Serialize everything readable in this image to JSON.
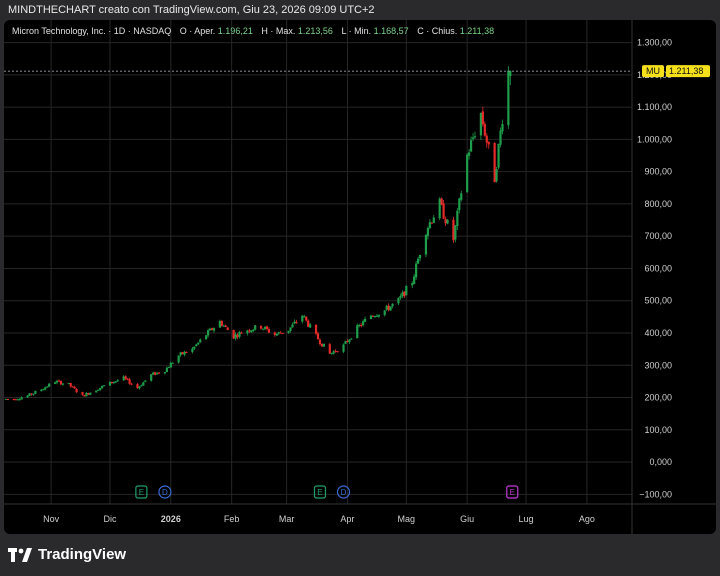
{
  "header": {
    "credit": "MINDTHECHART creato con TradingView.com, Giu 23, 2026 09:09 UTC+2"
  },
  "legend": {
    "symbol": "Micron Technology, Inc. · 1D · NASDAQ",
    "open_label": "O · Aper.",
    "open": "1.196,21",
    "high_label": "H · Max.",
    "high": "1.213,56",
    "low_label": "L · Min.",
    "low": "1.168,57",
    "close_label": "C · Chius.",
    "close": "1.211,38"
  },
  "price_tag": {
    "ticker": "MU",
    "value": "1.211,38",
    "color": "#f5e11b"
  },
  "footer": {
    "brand": "TradingView"
  },
  "colors": {
    "up": "#1e9e4a",
    "down": "#e52a2a",
    "earnings": "#1e9e6a",
    "dividend": "#3a6bd8",
    "earnings_next": "#c23ad8"
  },
  "events": [
    {
      "type": "earnings",
      "label": "E",
      "date": "2025-12-17"
    },
    {
      "type": "dividend",
      "label": "D",
      "date": "2025-12-29"
    },
    {
      "type": "earnings",
      "label": "E",
      "date": "2026-03-18"
    },
    {
      "type": "dividend",
      "label": "D",
      "date": "2026-03-30"
    },
    {
      "type": "earnings",
      "label": "E",
      "date": "2026-06-24"
    }
  ],
  "chart_data": {
    "type": "candlestick",
    "title": "Micron Technology, Inc. · 1D · NASDAQ",
    "y_ticks": [
      "1.300,00",
      "1.200,00",
      "1.100,00",
      "1.000,00",
      "900,00",
      "800,00",
      "700,00",
      "600,00",
      "500,00",
      "400,00",
      "300,00",
      "200,00",
      "100,00",
      "0,000",
      "−100,00"
    ],
    "y_tick_values": [
      1300,
      1200,
      1100,
      1000,
      900,
      800,
      700,
      600,
      500,
      400,
      300,
      200,
      100,
      0,
      -100
    ],
    "x_ticks": [
      "Nov",
      "Dic",
      "2026",
      "Feb",
      "Mar",
      "Apr",
      "Mag",
      "Giu",
      "Lug",
      "Ago"
    ],
    "x_tick_dates": [
      "2025-11-01",
      "2025-12-01",
      "2026-01-01",
      "2026-02-01",
      "2026-03-01",
      "2026-04-01",
      "2026-05-01",
      "2026-06-01",
      "2026-07-01",
      "2026-08-01"
    ],
    "ylim": [
      -130,
      1370
    ],
    "grid": true,
    "series_points": [
      [
        "2025-10-13",
        195
      ],
      [
        "2025-10-20",
        205
      ],
      [
        "2025-10-27",
        225
      ],
      [
        "2025-11-03",
        250
      ],
      [
        "2025-11-10",
        240
      ],
      [
        "2025-11-17",
        205
      ],
      [
        "2025-11-24",
        225
      ],
      [
        "2025-12-01",
        245
      ],
      [
        "2025-12-08",
        260
      ],
      [
        "2025-12-15",
        230
      ],
      [
        "2025-12-22",
        270
      ],
      [
        "2025-12-29",
        285
      ],
      [
        "2026-01-05",
        330
      ],
      [
        "2026-01-12",
        350
      ],
      [
        "2026-01-19",
        395
      ],
      [
        "2026-01-26",
        435
      ],
      [
        "2026-02-02",
        390
      ],
      [
        "2026-02-09",
        410
      ],
      [
        "2026-02-16",
        420
      ],
      [
        "2026-02-23",
        395
      ],
      [
        "2026-03-02",
        410
      ],
      [
        "2026-03-09",
        455
      ],
      [
        "2026-03-16",
        390
      ],
      [
        "2026-03-23",
        335
      ],
      [
        "2026-03-30",
        360
      ],
      [
        "2026-04-06",
        415
      ],
      [
        "2026-04-13",
        455
      ],
      [
        "2026-04-20",
        470
      ],
      [
        "2026-04-27",
        500
      ],
      [
        "2026-05-04",
        560
      ],
      [
        "2026-05-11",
        720
      ],
      [
        "2026-05-18",
        800
      ],
      [
        "2026-05-25",
        690
      ],
      [
        "2026-06-01",
        950
      ],
      [
        "2026-06-08",
        1080
      ],
      [
        "2026-06-15",
        880
      ],
      [
        "2026-06-22",
        1211
      ]
    ],
    "last_candle": {
      "date": "2026-06-23",
      "open": 1196.21,
      "high": 1213.56,
      "low": 1168.57,
      "close": 1211.38
    }
  }
}
